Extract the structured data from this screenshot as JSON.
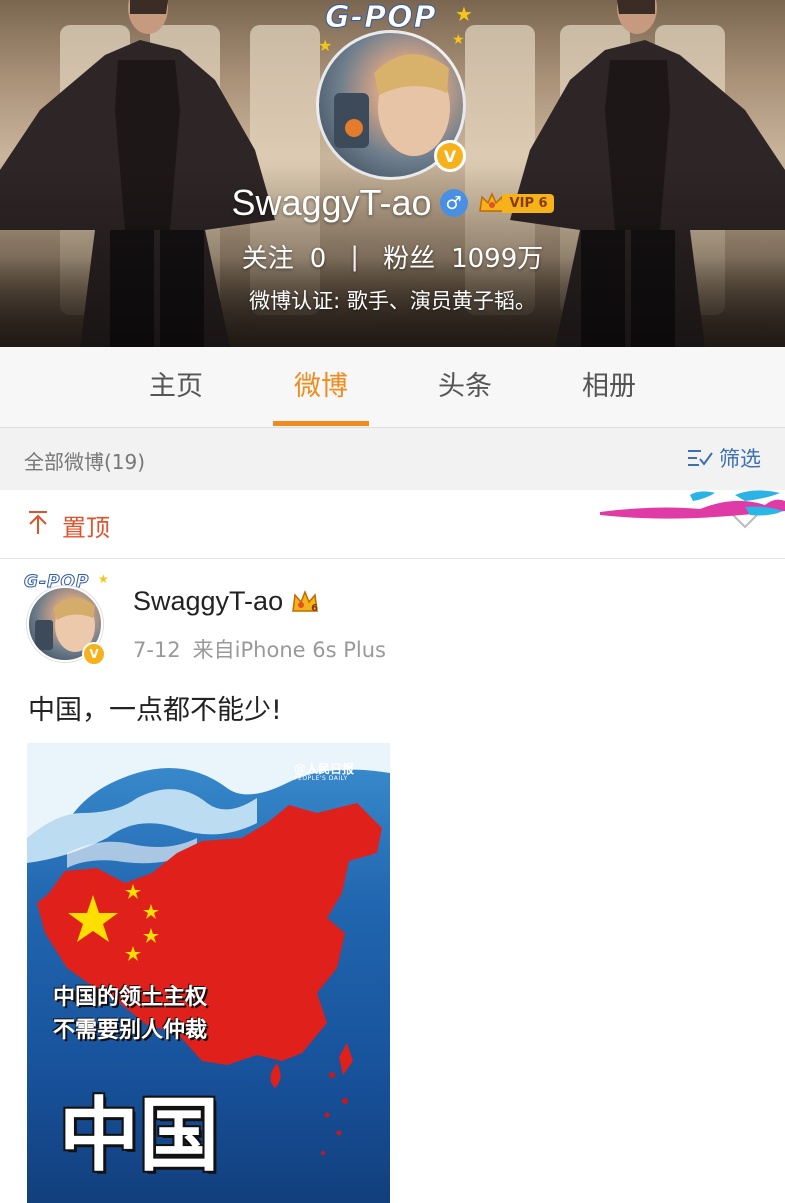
{
  "header": {
    "badge_text": "G-POP",
    "username": "SwaggyT-ao",
    "gender_icon": "male-icon",
    "vip_label": "VIP 6",
    "verified_badge": "V",
    "following_label": "关注",
    "following_count": "0",
    "stat_separator": "|",
    "followers_label": "粉丝",
    "followers_count": "1099万",
    "certification": "微博认证: 歌手、演员黄子韬。"
  },
  "tabs": [
    {
      "label": "主页"
    },
    {
      "label": "微博"
    },
    {
      "label": "头条"
    },
    {
      "label": "相册"
    }
  ],
  "active_tab": "微博",
  "filterbar": {
    "all_label": "全部微博(19)",
    "filter_label": "筛选"
  },
  "pinned": {
    "label": "置顶"
  },
  "post": {
    "badge_text": "G-POP",
    "username": "SwaggyT-ao",
    "crown_level": "6",
    "verified_badge": "V",
    "date": "7-12",
    "source": "来自iPhone 6s Plus",
    "text": "中国，一点都不能少!",
    "image": {
      "logo_text": "@人民日报",
      "logo_sub": "PEOPLE'S DAILY",
      "caption_line1": "中国的领土主权",
      "caption_line2": "不需要别人仲裁",
      "big_text": "中国"
    }
  },
  "colors": {
    "accent_orange": "#f28b1e",
    "pinned_red": "#e0522c",
    "filter_blue": "#3d6fb3",
    "verified_gold": "#f6b11b",
    "map_red": "#e0201b"
  }
}
